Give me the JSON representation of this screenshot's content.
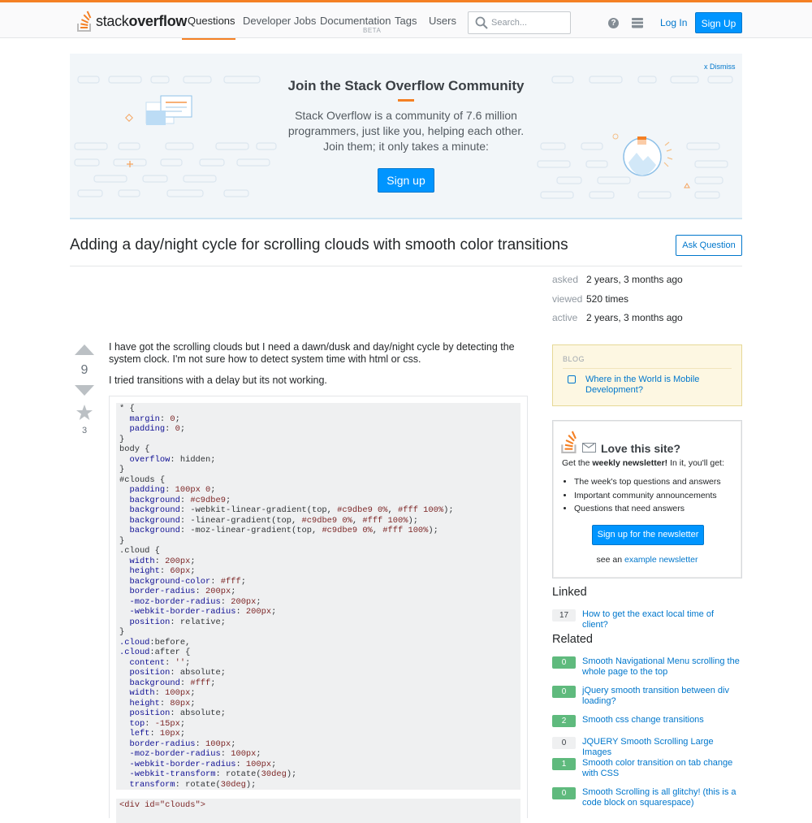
{
  "header": {
    "logo_text_regular": "stack",
    "logo_text_bold": "overflow",
    "nav": [
      "Questions",
      "Developer Jobs",
      "Documentation",
      "Tags",
      "Users"
    ],
    "nav_beta_label": "BETA",
    "search_placeholder": "Search...",
    "help_icon_glyph": "?",
    "login_label": "Log In",
    "signup_label": "Sign Up",
    "accent_color": "#f48024",
    "primary_color": "#0095ff"
  },
  "hero": {
    "title": "Join the Stack Overflow Community",
    "text": "Stack Overflow is a community of 7.6 million programmers, just like you, helping each other. Join them; it only takes a minute:",
    "button_label": "Sign up",
    "dismiss_label": "x Dismiss"
  },
  "question": {
    "title": "Adding a day/night cycle for scrolling clouds with smooth color transitions",
    "ask_button": "Ask Question",
    "votes": "9",
    "favorites": "3",
    "paragraph1": "I have got the scrolling clouds but I need a dawn/dusk and day/night cycle by detecting the system clock. I'm not sure how to detect system time with html or css.",
    "paragraph2": "I tried transitions with a delay but its not working.",
    "code_html_line": "<div id=\"clouds\">"
  },
  "stats": [
    {
      "key": "asked",
      "value": "2 years, 3 months ago"
    },
    {
      "key": "viewed",
      "value": "520 times"
    },
    {
      "key": "active",
      "value": "2 years, 3 months ago"
    }
  ],
  "blog": {
    "heading": "BLOG",
    "link": "Where in the World is Mobile Development?"
  },
  "newsletter": {
    "title": "Love this site?",
    "sub_pre": "Get the ",
    "sub_bold": "weekly newsletter!",
    "sub_post": " In it, you'll get:",
    "items": [
      "The week's top questions and answers",
      "Important community announcements",
      "Questions that need answers"
    ],
    "button": "Sign up for the newsletter",
    "foot_pre": "see an ",
    "foot_link": "example newsletter"
  },
  "linked": {
    "heading": "Linked",
    "items": [
      {
        "count": "17",
        "title": "How to get the exact local time of client?"
      }
    ]
  },
  "related": {
    "heading": "Related",
    "items": [
      {
        "count": "0",
        "title": "Smooth Navigational Menu scrolling the whole page to the top"
      },
      {
        "count": "0",
        "title": "jQuery smooth transition between div loading?"
      },
      {
        "count": "2",
        "title": "Smooth css change transitions"
      },
      {
        "count": "0",
        "title": "JQUERY Smooth Scrolling Large Images"
      },
      {
        "count": "1",
        "title": "Smooth color transition on tab change with CSS"
      },
      {
        "count": "0",
        "title": "Smooth Scrolling is all glitchy! (this is a code block on squarespace)"
      }
    ]
  }
}
